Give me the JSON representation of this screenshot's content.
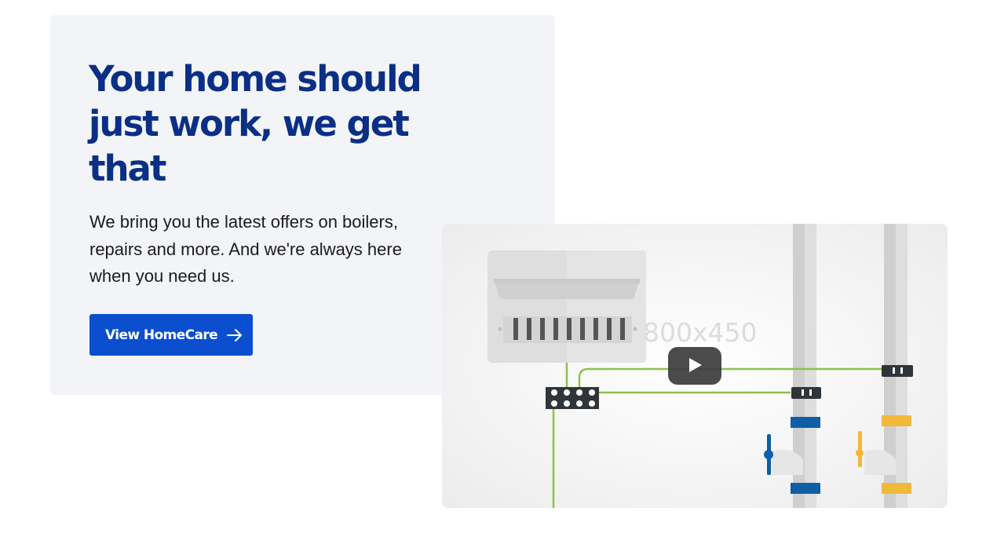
{
  "hero": {
    "headline": "Your home should just work, we get that",
    "body": "We bring you the latest offers on boilers, repairs and more. And we're always here when you need us.",
    "cta_label": "View HomeCare"
  },
  "video": {
    "placeholder_label": "800x450",
    "play_icon": "play-icon"
  },
  "colors": {
    "headline": "#0a2f85",
    "cta_background": "#0b4fcf",
    "card_background": "#f2f4f7"
  }
}
